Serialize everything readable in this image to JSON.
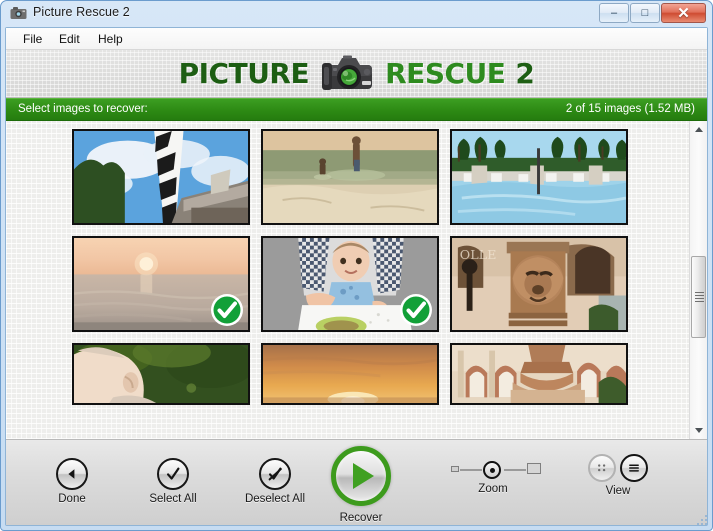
{
  "window": {
    "title": "Picture Rescue 2",
    "icon": "camera-icon",
    "controls": {
      "minimize": "–",
      "maximize": "□",
      "close": "✕"
    }
  },
  "menubar": {
    "items": [
      {
        "label": "File"
      },
      {
        "label": "Edit"
      },
      {
        "label": "Help"
      }
    ]
  },
  "logo": {
    "word1": "PICTURE",
    "word2": "RESCUE",
    "word3": "2",
    "icon": "dslr-camera-icon",
    "accent_color": "#2e8b1f"
  },
  "statusbar": {
    "left_text": "Select images to recover:",
    "right_text": "2 of 15 images (1.52 MB)",
    "background_color": "#2d8a14",
    "selected_count": 2,
    "total_count": 15,
    "total_size": "1.52 MB"
  },
  "grid": {
    "columns": 3,
    "thumbnails": [
      {
        "id": "thumb-1",
        "alt": "lighthouse-with-clouds",
        "selected": false
      },
      {
        "id": "thumb-2",
        "alt": "children-wading-at-beach",
        "selected": false
      },
      {
        "id": "thumb-3",
        "alt": "resort-pool-with-palms",
        "selected": false
      },
      {
        "id": "thumb-4",
        "alt": "ocean-sunset",
        "selected": true
      },
      {
        "id": "thumb-5",
        "alt": "baby-in-high-chair",
        "selected": true
      },
      {
        "id": "thumb-6",
        "alt": "stone-lion-fountain",
        "selected": false
      },
      {
        "id": "thumb-7",
        "alt": "elderly-man-portrait",
        "selected": false
      },
      {
        "id": "thumb-8",
        "alt": "orange-sunset-over-water",
        "selected": false
      },
      {
        "id": "thumb-9",
        "alt": "arched-courtyard-fountain",
        "selected": false
      }
    ],
    "check_badge_color": "#12a038"
  },
  "scrollbar": {
    "up_arrow": "▲",
    "down_arrow": "▼",
    "thumb_position_percent": 42
  },
  "toolbar": {
    "done": {
      "label": "Done",
      "icon": "back-triangle-icon"
    },
    "select_all": {
      "label": "Select All",
      "icon": "check-icon"
    },
    "deselect_all": {
      "label": "Deselect All",
      "icon": "check-slashed-icon"
    },
    "recover": {
      "label": "Recover",
      "icon": "play-icon",
      "accent_color": "#3d9b1d"
    },
    "zoom": {
      "label": "Zoom",
      "value_percent": 50,
      "min_icon": "small-square-icon",
      "max_icon": "large-square-icon"
    },
    "view": {
      "label": "View",
      "grid_icon": "grid-view-icon",
      "list_icon": "list-view-icon",
      "active": "list"
    }
  }
}
